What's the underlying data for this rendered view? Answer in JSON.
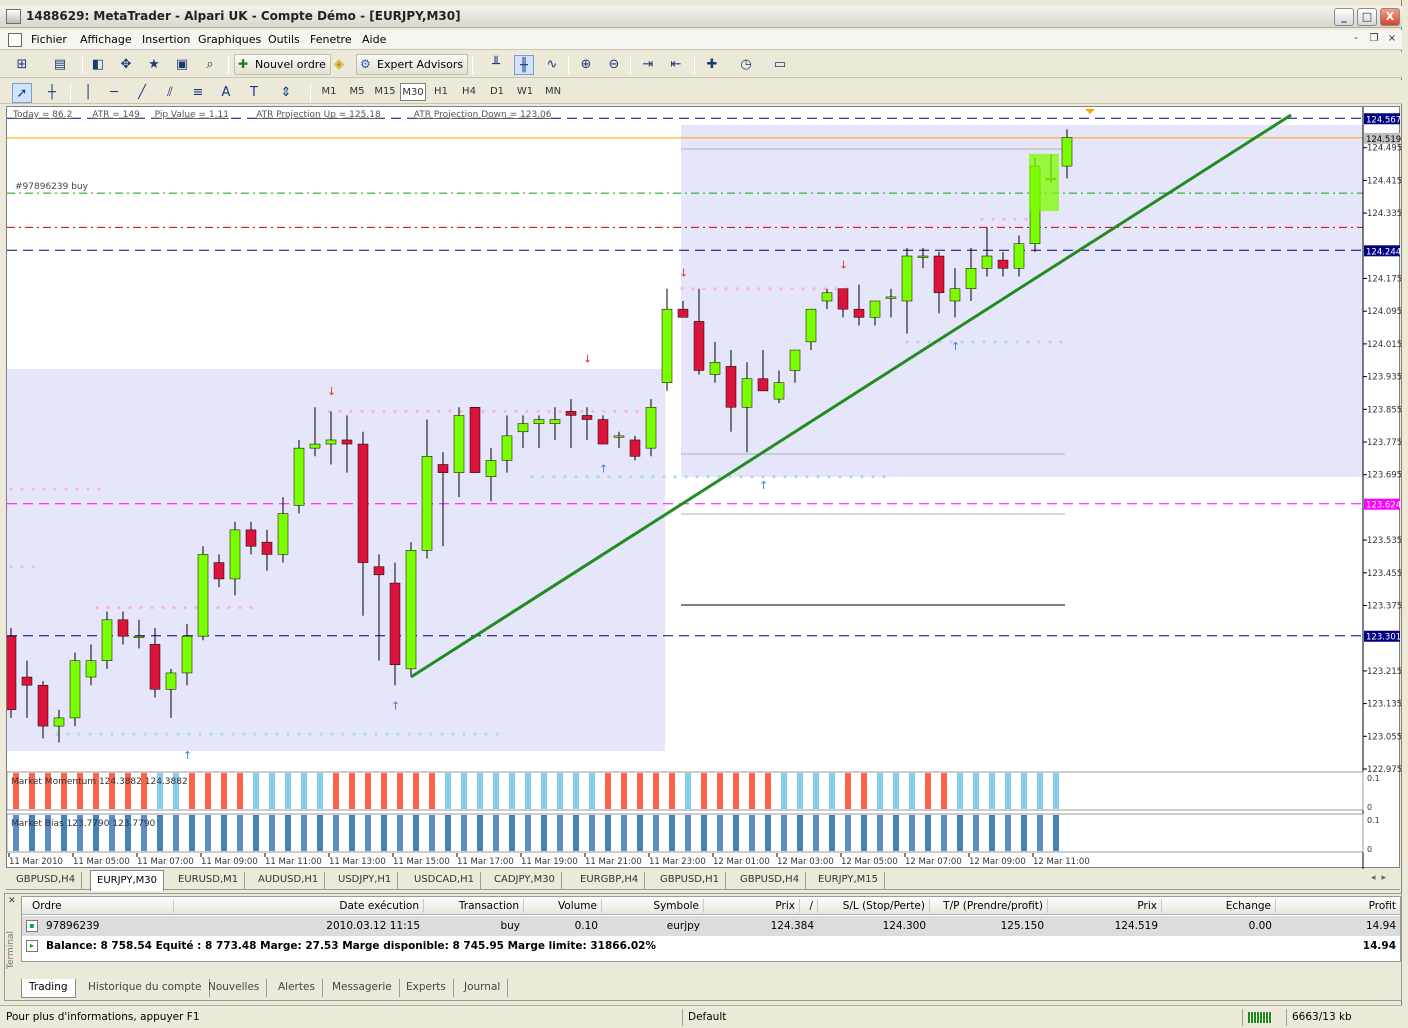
{
  "window": {
    "title": "1488629: MetaTrader - Alpari UK - Compte Démo - [EURJPY,M30]",
    "buttons": {
      "minimize": "_",
      "maximize": "□",
      "close": "X"
    }
  },
  "menu": {
    "items": [
      "Fichier",
      "Affichage",
      "Insertion",
      "Graphiques",
      "Outils",
      "Fenetre",
      "Aide"
    ],
    "mdi": {
      "minimize": "-",
      "restore": "❐",
      "close": "×"
    }
  },
  "toolbar": {
    "new_order": "Nouvel ordre",
    "expert_advisors": "Expert Advisors",
    "timeframes": [
      "M1",
      "M5",
      "M15",
      "M30",
      "H1",
      "H4",
      "D1",
      "W1",
      "MN"
    ],
    "active_timeframe": "M30"
  },
  "chart": {
    "info_labels": [
      "Today = 86.2",
      "ATR = 149",
      "Pip Value = 1.11",
      "ATR Projection Up = 125.18",
      "ATR Projection Down = 123.06"
    ],
    "order_label": "#97896239 buy",
    "price_ticks": [
      "124.495",
      "124.415",
      "124.335",
      "124.175",
      "124.095",
      "124.015",
      "123.935",
      "123.855",
      "123.775",
      "123.695",
      "123.535",
      "123.455",
      "123.375",
      "123.215",
      "123.135",
      "123.055",
      "122.975"
    ],
    "price_boxes": [
      {
        "label": "124.567",
        "color": "#000080",
        "text": "#ffffff"
      },
      {
        "label": "124.519",
        "color": "#C0C0C0",
        "text": "#000000"
      },
      {
        "label": "124.244",
        "color": "#000080",
        "text": "#ffffff"
      },
      {
        "label": "123.624",
        "color": "#FF00FF",
        "text": "#ffffff"
      },
      {
        "label": "123.301",
        "color": "#000080",
        "text": "#ffffff"
      }
    ],
    "time_labels": [
      "11 Mar 2010",
      "11 Mar 05:00",
      "11 Mar 07:00",
      "11 Mar 09:00",
      "11 Mar 11:00",
      "11 Mar 13:00",
      "11 Mar 15:00",
      "11 Mar 17:00",
      "11 Mar 19:00",
      "11 Mar 21:00",
      "11 Mar 23:00",
      "12 Mar 01:00",
      "12 Mar 03:00",
      "12 Mar 05:00",
      "12 Mar 07:00",
      "12 Mar 09:00",
      "12 Mar 11:00"
    ],
    "indicator1": {
      "label": "Market Momentum 124.3882 124.3882",
      "scale_top": "0.1",
      "scale_bottom": "0"
    },
    "indicator2": {
      "label": "Market Bias 123.7790 123.7790",
      "scale_top": "0.1",
      "scale_bottom": "0"
    },
    "colors": {
      "bull": "#7CFC00",
      "bear": "#DC143C",
      "trend": "#228B22",
      "zone": "#E6E6FA"
    }
  },
  "chart_data": {
    "type": "candlestick",
    "symbol": "EURJPY",
    "timeframe": "M30",
    "y_range": [
      122.975,
      124.575
    ],
    "candles": [
      [
        123.3,
        123.32,
        123.1,
        123.12
      ],
      [
        123.2,
        123.24,
        123.1,
        123.18
      ],
      [
        123.18,
        123.19,
        123.05,
        123.08
      ],
      [
        123.08,
        123.12,
        123.04,
        123.1
      ],
      [
        123.1,
        123.26,
        123.08,
        123.24
      ],
      [
        123.2,
        123.28,
        123.18,
        123.24
      ],
      [
        123.24,
        123.36,
        123.22,
        123.34
      ],
      [
        123.34,
        123.36,
        123.28,
        123.3
      ],
      [
        123.3,
        123.34,
        123.27,
        123.3
      ],
      [
        123.28,
        123.32,
        123.15,
        123.17
      ],
      [
        123.17,
        123.22,
        123.1,
        123.21
      ],
      [
        123.21,
        123.33,
        123.18,
        123.3
      ],
      [
        123.3,
        123.52,
        123.29,
        123.5
      ],
      [
        123.48,
        123.5,
        123.42,
        123.44
      ],
      [
        123.44,
        123.58,
        123.4,
        123.56
      ],
      [
        123.56,
        123.58,
        123.5,
        123.52
      ],
      [
        123.53,
        123.56,
        123.46,
        123.5
      ],
      [
        123.5,
        123.64,
        123.48,
        123.6
      ],
      [
        123.62,
        123.78,
        123.6,
        123.76
      ],
      [
        123.76,
        123.86,
        123.74,
        123.77
      ],
      [
        123.77,
        123.85,
        123.72,
        123.78
      ],
      [
        123.78,
        123.84,
        123.7,
        123.77
      ],
      [
        123.77,
        123.8,
        123.35,
        123.48
      ],
      [
        123.47,
        123.5,
        123.24,
        123.45
      ],
      [
        123.43,
        123.48,
        123.18,
        123.23
      ],
      [
        123.22,
        123.53,
        123.2,
        123.51
      ],
      [
        123.51,
        123.83,
        123.49,
        123.74
      ],
      [
        123.72,
        123.75,
        123.52,
        123.7
      ],
      [
        123.7,
        123.86,
        123.64,
        123.84
      ],
      [
        123.86,
        123.86,
        123.7,
        123.7
      ],
      [
        123.69,
        123.76,
        123.63,
        123.73
      ],
      [
        123.73,
        123.84,
        123.7,
        123.79
      ],
      [
        123.8,
        123.84,
        123.76,
        123.82
      ],
      [
        123.82,
        123.84,
        123.76,
        123.83
      ],
      [
        123.82,
        123.86,
        123.78,
        123.83
      ],
      [
        123.85,
        123.88,
        123.76,
        123.84
      ],
      [
        123.84,
        123.86,
        123.78,
        123.83
      ],
      [
        123.83,
        123.84,
        123.77,
        123.77
      ],
      [
        123.79,
        123.8,
        123.76,
        123.79
      ],
      [
        123.78,
        123.79,
        123.73,
        123.74
      ],
      [
        123.76,
        123.88,
        123.74,
        123.86
      ],
      [
        123.92,
        124.15,
        123.9,
        124.1
      ],
      [
        124.1,
        124.12,
        124.08,
        124.08
      ],
      [
        124.07,
        124.15,
        123.94,
        123.95
      ],
      [
        123.94,
        124.02,
        123.92,
        123.97
      ],
      [
        123.96,
        124.0,
        123.8,
        123.86
      ],
      [
        123.86,
        123.97,
        123.75,
        123.93
      ],
      [
        123.93,
        124.0,
        123.9,
        123.9
      ],
      [
        123.88,
        123.95,
        123.87,
        123.92
      ],
      [
        123.95,
        124.0,
        123.92,
        124.0
      ],
      [
        124.02,
        124.1,
        124.0,
        124.1
      ],
      [
        124.12,
        124.15,
        124.1,
        124.14
      ],
      [
        124.15,
        124.15,
        124.08,
        124.1
      ],
      [
        124.1,
        124.16,
        124.06,
        124.08
      ],
      [
        124.08,
        124.12,
        124.06,
        124.12
      ],
      [
        124.13,
        124.15,
        124.08,
        124.13
      ],
      [
        124.12,
        124.25,
        124.04,
        124.23
      ],
      [
        124.23,
        124.25,
        124.2,
        124.23
      ],
      [
        124.23,
        124.24,
        124.09,
        124.14
      ],
      [
        124.12,
        124.2,
        124.08,
        124.15
      ],
      [
        124.15,
        124.25,
        124.12,
        124.2
      ],
      [
        124.2,
        124.3,
        124.18,
        124.23
      ],
      [
        124.22,
        124.24,
        124.18,
        124.2
      ],
      [
        124.2,
        124.28,
        124.18,
        124.26
      ],
      [
        124.26,
        124.47,
        124.24,
        124.45
      ],
      [
        124.42,
        124.48,
        124.41,
        124.42
      ],
      [
        124.45,
        124.54,
        124.42,
        124.52
      ]
    ],
    "trendline": {
      "from": [
        25,
        123.2
      ],
      "to": [
        80,
        124.575
      ]
    },
    "hlines": [
      {
        "price": 124.567,
        "style": "dashed",
        "color": "#000080"
      },
      {
        "price": 124.519,
        "style": "solid",
        "color": "#FFA500"
      },
      {
        "price": 124.384,
        "style": "dashdot",
        "color": "#00AA00"
      },
      {
        "price": 124.3,
        "style": "dashdot",
        "color": "#CC0000"
      },
      {
        "price": 124.244,
        "style": "dashed",
        "color": "#000080"
      },
      {
        "price": 123.624,
        "style": "dashed",
        "color": "#FF00FF"
      },
      {
        "price": 123.301,
        "style": "dashed",
        "color": "#000080"
      }
    ]
  },
  "symbol_tabs": [
    "GBPUSD,H4",
    "EURJPY,M30",
    "EURUSD,M1",
    "AUDUSD,H1",
    "USDJPY,H1",
    "USDCAD,H1",
    "CADJPY,M30",
    "EURGBP,H4",
    "GBPUSD,H1",
    "GBPUSD,H4",
    "EURJPY,M15"
  ],
  "active_symbol_tab": "EURJPY,M30",
  "terminal": {
    "label": "Terminal",
    "columns": [
      "Ordre",
      "Date exécution",
      "Transaction",
      "Volume",
      "Symbole",
      "Prix",
      "/",
      "S/L (Stop/Perte)",
      "T/P (Prendre/profit)",
      "Prix",
      "Echange",
      "Profit"
    ],
    "order": {
      "id": "97896239",
      "date": "2010.03.12 11:15",
      "type": "buy",
      "volume": "0.10",
      "symbol": "eurjpy",
      "price": "124.384",
      "sl": "124.300",
      "tp": "125.150",
      "current_price": "124.519",
      "swap": "0.00",
      "profit": "14.94"
    },
    "summary": "Balance: 8 758.54  Equité : 8 773.48  Marge: 27.53  Marge disponible: 8 745.95  Marge limite: 31866.02%",
    "total_profit": "14.94",
    "tabs": [
      "Trading",
      "Historique du compte",
      "Nouvelles",
      "Alertes",
      "Messagerie",
      "Experts",
      "Journal"
    ],
    "active_tab": "Trading"
  },
  "status": {
    "help": "Pour plus d'informations, appuyer F1",
    "profile": "Default",
    "traffic": "6663/13 kb"
  }
}
